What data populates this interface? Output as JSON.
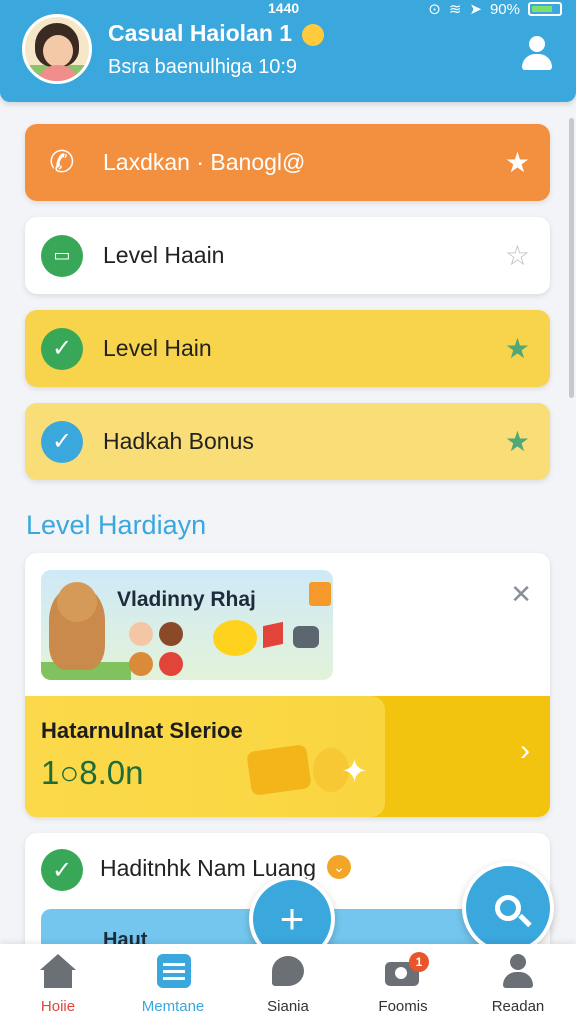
{
  "status_bar": {
    "time": "1440",
    "battery": "90%"
  },
  "header": {
    "title": "Casual Haiolan 1",
    "subtitle": "Bsra baenulhiga 10:9"
  },
  "tasks": [
    {
      "label": "Laxdkan · Banogl@",
      "starred": true
    },
    {
      "label": "Level Haain",
      "starred": false
    },
    {
      "label": "Level Hain",
      "starred": true
    },
    {
      "label": "Hadkah Bonus",
      "starred": true
    }
  ],
  "section": {
    "title": "Level Hardiayn"
  },
  "promo": {
    "text": "Vladinny  Rhaj"
  },
  "banner": {
    "title": "Hatarnulnat Slerioe",
    "value": "1○8.0n"
  },
  "bottom_item": {
    "label": "Haditnhk Nam Luang",
    "strip_text": "Haut"
  },
  "tabs": [
    {
      "label": "Hoiie",
      "icon": "home-icon"
    },
    {
      "label": "Memtane",
      "icon": "list-icon"
    },
    {
      "label": "Siania",
      "icon": "chat-bubble-icon"
    },
    {
      "label": "Foomis",
      "icon": "camera-icon",
      "badge": "1"
    },
    {
      "label": "Readan",
      "icon": "person-icon"
    }
  ],
  "colors": {
    "accent": "#3aa7dd",
    "orange": "#f39040",
    "yellow": "#f8d44c",
    "green": "#38a858"
  }
}
